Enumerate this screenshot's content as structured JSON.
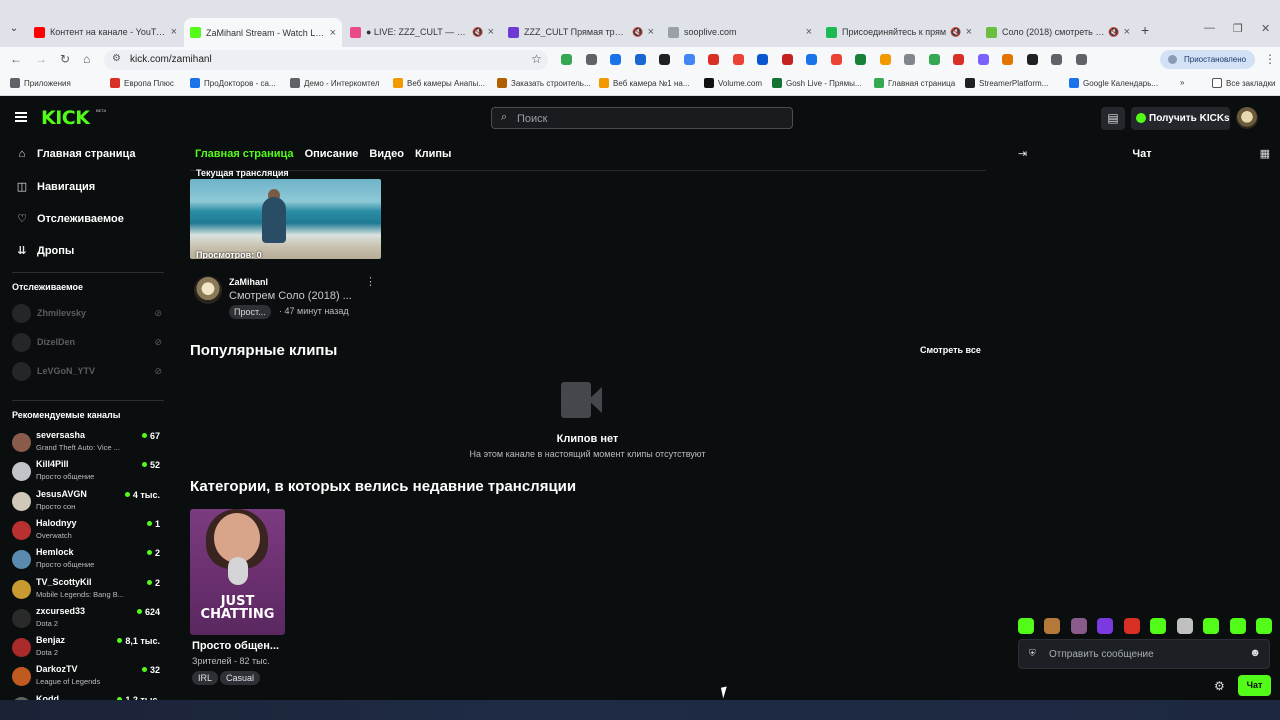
{
  "browser": {
    "tabs": [
      {
        "title": "Контент на канале - YouTube S",
        "color": "#ff0000",
        "active": false,
        "sound": false
      },
      {
        "title": "ZaMihanl Stream - Watch Live",
        "color": "#53fc18",
        "active": true,
        "sound": false
      },
      {
        "title": "● LIVE: ZZZ_CULT — stream.spa",
        "color": "#e84a8a",
        "active": false,
        "sound": true
      },
      {
        "title": "ZZZ_CULT Прямая трансляц",
        "color": "#6e3ad6",
        "active": false,
        "sound": true
      },
      {
        "title": "sooplive.com",
        "color": "#9aa0a6",
        "active": false,
        "sound": false
      },
      {
        "title": "Присоединяйтесь к прям",
        "color": "#1db954",
        "active": false,
        "sound": true
      },
      {
        "title": "Соло (2018) смотреть онл",
        "color": "#6abf40",
        "active": false,
        "sound": true
      }
    ],
    "url": "kick.com/zamihanl",
    "paused_label": "Приостановлено",
    "bookmarks": [
      {
        "label": "Приложения",
        "color": "#5f6368"
      },
      {
        "label": "Европа Плюс",
        "color": "#d93025"
      },
      {
        "label": "ПроДокторов - са...",
        "color": "#1a73e8"
      },
      {
        "label": "Демо - Интеркомтел",
        "color": "#5f6368"
      },
      {
        "label": "Веб камеры Анапы...",
        "color": "#f29900"
      },
      {
        "label": "Заказать строитель...",
        "color": "#b06000"
      },
      {
        "label": "Веб камера №1 на...",
        "color": "#f29900"
      },
      {
        "label": "Volume.com",
        "color": "#111111"
      },
      {
        "label": "Gosh Live - Прямы...",
        "color": "#137333"
      },
      {
        "label": "Главная страница",
        "color": "#34a853"
      },
      {
        "label": "StreamerPlatform...",
        "color": "#202124"
      },
      {
        "label": "Google Календарь...",
        "color": "#1a73e8"
      }
    ],
    "all_bookmarks": "Все закладки",
    "ext_colors": [
      "#34a853",
      "#5f6368",
      "#1a73e8",
      "#1967d2",
      "#202124",
      "#4285f4",
      "#d93025",
      "#ea4335",
      "#0b57d0",
      "#c5221f",
      "#1a73e8",
      "#ea4335",
      "#188038",
      "#f29900",
      "#80868b",
      "#34a853",
      "#d93025",
      "#7b61ff",
      "#e37400",
      "#202124",
      "#5f6368",
      "#5f6368"
    ]
  },
  "kick": {
    "logo": "KICK",
    "beta": "BETA",
    "search_placeholder": "Поиск",
    "get_kicks": "Получить KICKs",
    "nav": [
      {
        "icon": "⌂",
        "label": "Главная страница"
      },
      {
        "icon": "◫",
        "label": "Навигация"
      },
      {
        "icon": "♡",
        "label": "Отслеживаемое"
      },
      {
        "icon": "⇊",
        "label": "Дропы"
      }
    ],
    "following_title": "Отслеживаемое",
    "following": [
      {
        "name": "Zhmilevsky"
      },
      {
        "name": "DizelDen"
      },
      {
        "name": "LeVGoN_YTV"
      }
    ],
    "recommended_title": "Рекомендуемые каналы",
    "recommended": [
      {
        "name": "seversasha",
        "category": "Grand Theft Auto: Vice ...",
        "viewers": "67",
        "color": "#8a5a4a"
      },
      {
        "name": "Kill4Pill",
        "category": "Просто общение",
        "viewers": "52",
        "color": "#c0c4c8"
      },
      {
        "name": "JesusAVGN",
        "category": "Просто сон",
        "viewers": "4 тыс.",
        "color": "#d0c8b8"
      },
      {
        "name": "Halodnyy",
        "category": "Overwatch",
        "viewers": "1",
        "color": "#b83030"
      },
      {
        "name": "Hemlock",
        "category": "Просто общение",
        "viewers": "2",
        "color": "#5a8ab0"
      },
      {
        "name": "TV_ScottyKil",
        "category": "Mobile Legends: Bang B...",
        "viewers": "2",
        "color": "#c89a30"
      },
      {
        "name": "zxcursed33",
        "category": "Dota 2",
        "viewers": "624",
        "color": "#2a2a2a"
      },
      {
        "name": "Benjaz",
        "category": "Dota 2",
        "viewers": "8,1 тыс.",
        "color": "#a82a2a"
      },
      {
        "name": "DarkozTV",
        "category": "League of Legends",
        "viewers": "32",
        "color": "#c05a20"
      },
      {
        "name": "Kodd",
        "category": "",
        "viewers": "1,2 тыс.",
        "color": "#606060"
      }
    ],
    "tabs": [
      {
        "label": "Главная страница",
        "active": true
      },
      {
        "label": "Описание",
        "active": false
      },
      {
        "label": "Видео",
        "active": false
      },
      {
        "label": "Клипы",
        "active": false
      }
    ],
    "current_stream": {
      "label": "Текущая трансляция",
      "views": "Просмотров: 0",
      "channel": "ZaMihanl",
      "title": "Смотрем Соло (2018) ...",
      "tag": "Прост...",
      "time": "· 47 минут назад"
    },
    "clips": {
      "title": "Популярные клипы",
      "see_all": "Смотреть все",
      "empty_title": "Клипов нет",
      "empty_sub": "На этом канале в настоящий момент клипы отсутствуют"
    },
    "categories": {
      "title": "Категории, в которых велись недавние трансляции",
      "card_text": "JUST CHATTING",
      "name": "Просто общен...",
      "viewers": "Зрителей - 82 тыс.",
      "tags": [
        "IRL",
        "Casual"
      ]
    },
    "chat": {
      "title": "Чат",
      "placeholder": "Отправить сообщение",
      "send": "Чат",
      "emote_colors": [
        "#53fc18",
        "#b5793a",
        "#8a5a8a",
        "#7a3adf",
        "#d93025",
        "#53fc18",
        "#c0c0c0",
        "#53fc18",
        "#53fc18",
        "#53fc18"
      ]
    }
  }
}
